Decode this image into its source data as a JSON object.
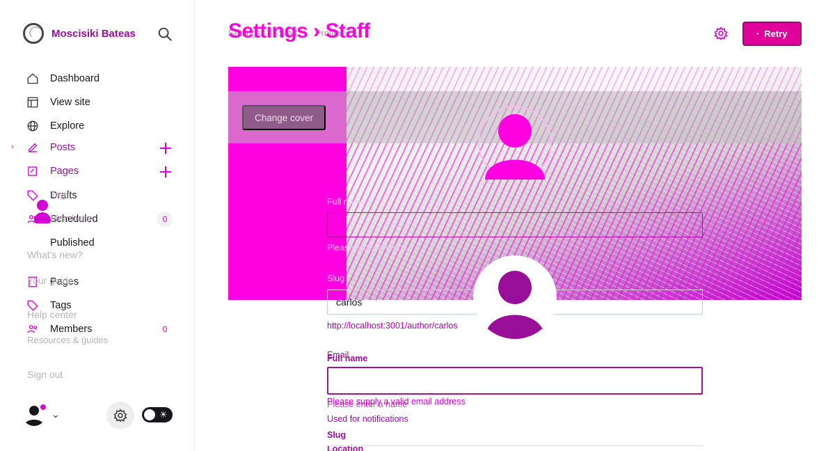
{
  "sidebar": {
    "brand": {
      "name": "Moscisiki Bateas",
      "ghost_name": "Moscicki, Bate.."
    },
    "nav": [
      {
        "label": "Dashboard",
        "icon": "home-icon"
      },
      {
        "label": "View site",
        "icon": "site-icon"
      },
      {
        "label": "Explore",
        "icon": "globe-icon"
      },
      {
        "label": "Posts",
        "icon": "edit-icon",
        "has_add": true
      },
      {
        "label": "Pages",
        "icon": "pages-icon",
        "has_add": true
      },
      {
        "label": "Drafts",
        "icon": "tag-icon"
      },
      {
        "label": "Scheduled",
        "icon": "members-icon",
        "count": "0"
      },
      {
        "label": "Published",
        "icon": ""
      },
      {
        "label": "Pages",
        "icon": "book-icon"
      },
      {
        "label": "Tags",
        "icon": "tag-icon"
      },
      {
        "label": "Members",
        "icon": "members-icon",
        "count": "0"
      }
    ],
    "ghost_items": {
      "tags": "Tags",
      "members": "Members",
      "whats_new": "What's new?",
      "your_guide": "Your guide",
      "help_center": "Help center",
      "resources": "Resources & guides",
      "sign_out": "Sign out"
    }
  },
  "header": {
    "title": "Settings › Staff",
    "breadcrumbs": [
      "Settings",
      "Staff",
      "Profile"
    ],
    "retry_label": "Retry"
  },
  "cover": {
    "change_label": "Change cover"
  },
  "form": {
    "full_name_label_ghost": "Full name",
    "full_name_hint_ghost": "Please enter a name",
    "slug_label_ghost": "Slug",
    "slug_value": "carlos",
    "slug_url": "http://localhost:3001/author/carlos",
    "email_label": "Email",
    "full_name_label": "Full name",
    "full_name_value": "",
    "email_hint": "Please supply a valid email address",
    "full_name_hint": "Please enter a name",
    "email_used": "Used for notifications",
    "slug_label": "Slug",
    "location_label": "Location"
  },
  "colors": {
    "accent": "#d400d4",
    "brand": "#ff00e0",
    "dark_magenta": "#9a0f9a"
  }
}
